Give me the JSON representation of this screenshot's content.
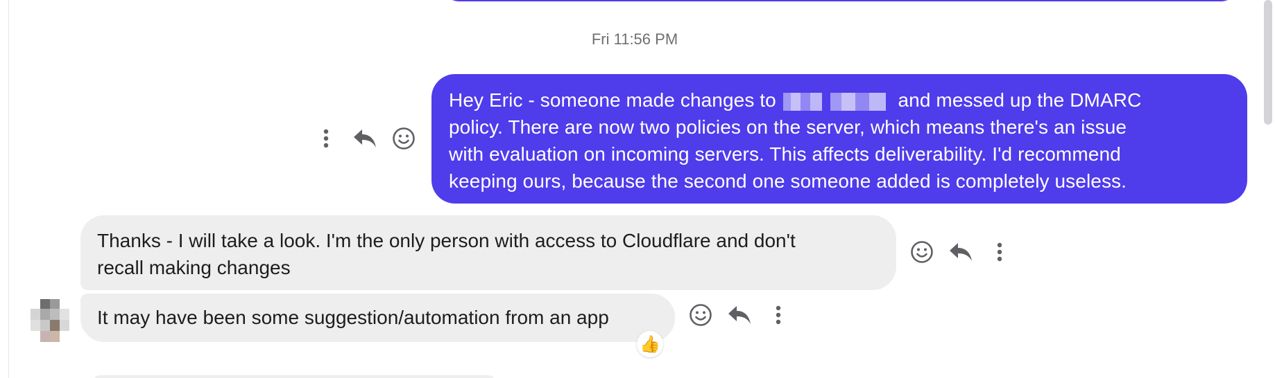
{
  "timestamp": "Fri 11:56 PM",
  "outgoing_message": {
    "line1_before": "Hey Eric - someone made changes to ",
    "line1_after": "  and messed up the DMARC",
    "line2": "policy. There are now two policies on the server, which means there's an issue",
    "line3": "with evaluation on incoming servers. This affects deliverability. I'd recommend",
    "line4": "keeping ours, because the second one someone added is completely useless."
  },
  "incoming_messages": [
    {
      "line1": "Thanks - I will take a look. I'm the only person with access to Cloudflare and don't",
      "line2": "recall making changes"
    },
    {
      "line1": "It may have been some suggestion/automation from an app",
      "reaction": "👍"
    }
  ],
  "icons": {
    "more": "more-vertical-icon",
    "reply": "reply-icon",
    "react": "emoji-smile-icon"
  },
  "colors": {
    "outgoing_bubble": "#4f3ceb",
    "incoming_bubble": "#eeeeef",
    "icon": "#5f5f64",
    "timestamp": "#6f6f6f"
  }
}
